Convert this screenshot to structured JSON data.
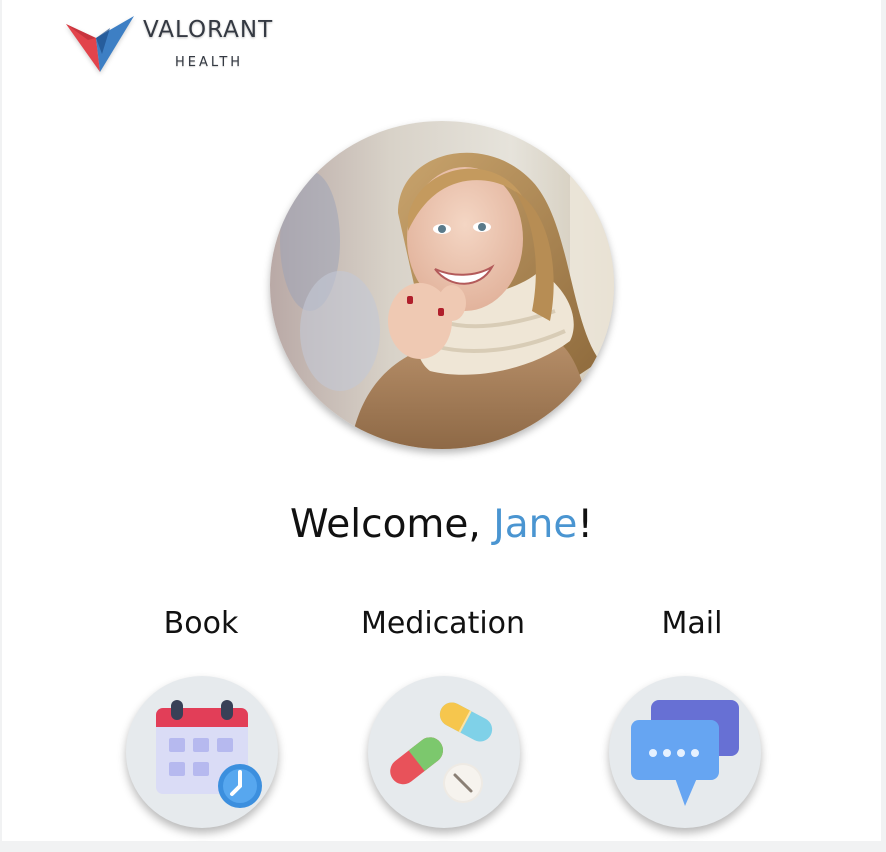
{
  "brand": {
    "name": "VALORANT",
    "sub": "HEALTH",
    "colors": {
      "red": "#e2434b",
      "blue": "#3d7fc4",
      "dark_blue": "#1d4f8c"
    }
  },
  "profile": {
    "avatar_icon": "user-photo",
    "greeting": "Welcome, ",
    "name": "Jane",
    "punctuation": "!",
    "accent": "#4a95d1"
  },
  "actions": [
    {
      "label": "Book",
      "icon": "calendar-clock-icon"
    },
    {
      "label": "Medication",
      "icon": "pills-icon"
    },
    {
      "label": "Mail",
      "icon": "chat-bubbles-icon"
    }
  ]
}
